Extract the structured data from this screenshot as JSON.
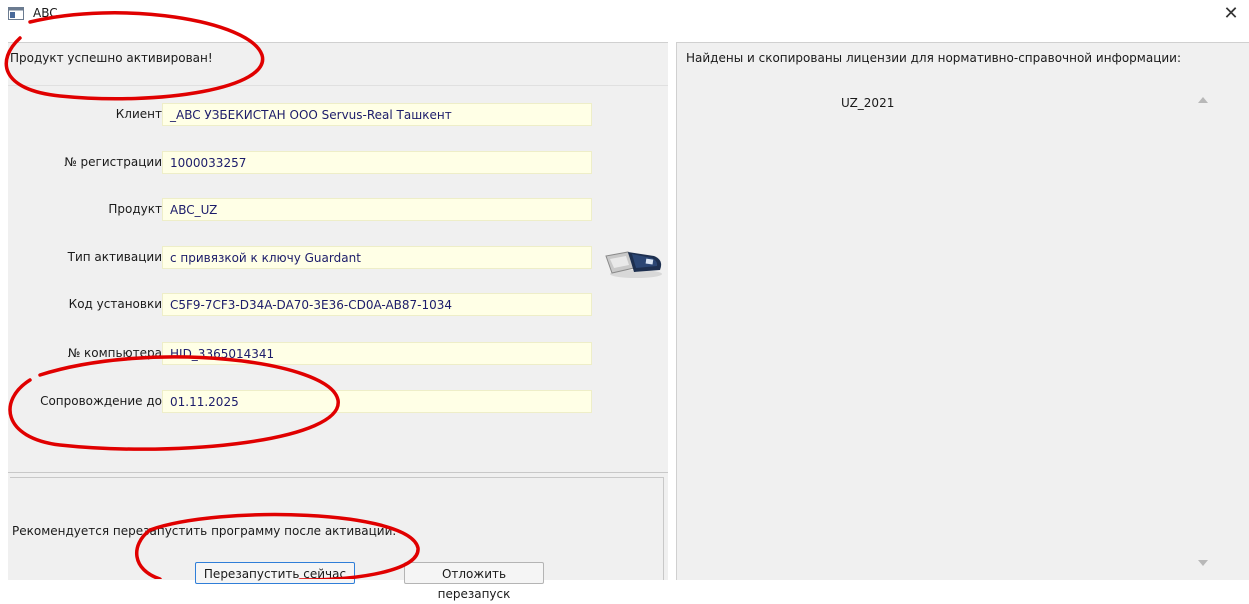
{
  "window": {
    "title": "ABC"
  },
  "status": {
    "message": "Продукт успешно активирован!"
  },
  "form": {
    "fields": [
      {
        "label": "Клиент",
        "value": "_ABC УЗБЕКИСТАН ООО Servus-Real Ташкент"
      },
      {
        "label": "№ регистрации",
        "value": "1000033257"
      },
      {
        "label": "Продукт",
        "value": "ABC_UZ"
      },
      {
        "label": "Тип активации",
        "value": "с привязкой к ключу Guardant"
      },
      {
        "label": "Код установки",
        "value": "C5F9-7CF3-D34A-DA70-3E36-CD0A-AB87-1034"
      },
      {
        "label": "№ компьютера",
        "value": "HID_3365014341"
      },
      {
        "label": "Сопровождение до",
        "value": "01.11.2025"
      }
    ]
  },
  "footer": {
    "recommendation": "Рекомендуется перезапустить программу после активации.",
    "restart_now_label": "Перезапустить сейчас",
    "postpone_label": "Отложить перезапуск"
  },
  "licenses": {
    "title": "Найдены и скопированы лицензии для нормативно-справочной информации:",
    "items": [
      "UZ_2021"
    ]
  },
  "icons": {
    "app": "app-window-icon",
    "close": "close-icon",
    "usb": "usb-dongle-icon",
    "scroll_up": "scroll-up-arrow-icon",
    "scroll_down": "scroll-down-arrow-icon"
  },
  "colors": {
    "panel_bg": "#f0f0f0",
    "field_bg": "#ffffe6",
    "field_text": "#1c1c6a",
    "annotation": "#e00000",
    "focus_border": "#2f7ed8"
  }
}
